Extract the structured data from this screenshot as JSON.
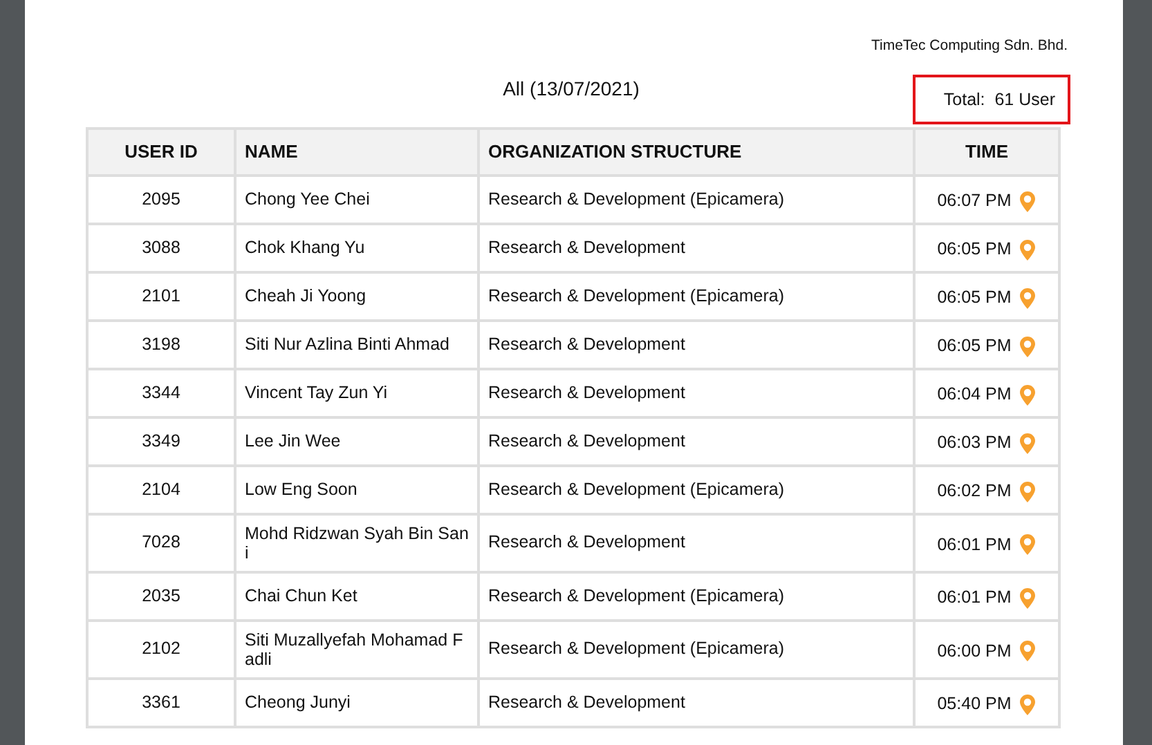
{
  "company": "TimeTec Computing Sdn. Bhd.",
  "title": "All (13/07/2021)",
  "total": "Total:  61 User",
  "table": {
    "columns": [
      "USER ID",
      "NAME",
      "ORGANIZATION STRUCTURE",
      "TIME"
    ],
    "rows": [
      {
        "user_id": "2095",
        "name": "Chong Yee Chei",
        "organization": "Research & Development (Epicamera)",
        "time": "06:07 PM"
      },
      {
        "user_id": "3088",
        "name": "Chok Khang Yu",
        "organization": "Research & Development",
        "time": "06:05 PM"
      },
      {
        "user_id": "2101",
        "name": "Cheah Ji Yoong",
        "organization": "Research & Development (Epicamera)",
        "time": "06:05 PM"
      },
      {
        "user_id": "3198",
        "name": "Siti Nur Azlina Binti Ahmad",
        "organization": "Research & Development",
        "time": "06:05 PM"
      },
      {
        "user_id": "3344",
        "name": "Vincent Tay Zun Yi",
        "organization": "Research & Development",
        "time": "06:04 PM"
      },
      {
        "user_id": "3349",
        "name": "Lee Jin Wee",
        "organization": "Research & Development",
        "time": "06:03 PM"
      },
      {
        "user_id": "2104",
        "name": "Low Eng Soon",
        "organization": "Research & Development (Epicamera)",
        "time": "06:02 PM"
      },
      {
        "user_id": "7028",
        "name": "Mohd Ridzwan Syah Bin Sani",
        "organization": "Research & Development",
        "time": "06:01 PM"
      },
      {
        "user_id": "2035",
        "name": "Chai Chun Ket",
        "organization": "Research & Development (Epicamera)",
        "time": "06:01 PM"
      },
      {
        "user_id": "2102",
        "name": "Siti Muzallyefah Mohamad Fadli",
        "organization": "Research & Development (Epicamera)",
        "time": "06:00 PM"
      },
      {
        "user_id": "3361",
        "name": "Cheong Junyi",
        "organization": "Research & Development",
        "time": "05:40 PM"
      }
    ]
  }
}
